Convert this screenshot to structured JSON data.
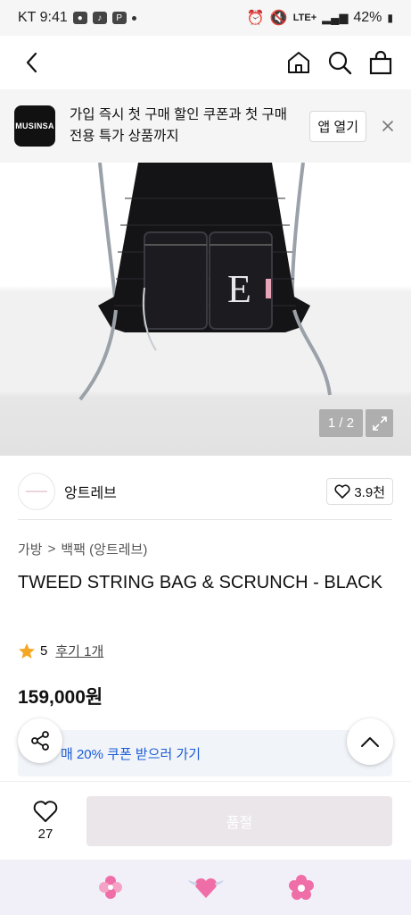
{
  "status_bar": {
    "carrier_time": "KT 9:41",
    "battery": "42%",
    "network": "LTE+"
  },
  "header": {
    "icons": [
      "back-icon",
      "home-icon",
      "search-icon",
      "bag-icon"
    ]
  },
  "promo": {
    "logo_text": "MUSINSA",
    "text": "가입 즉시 첫 구매 할인 쿠폰과 첫 구매 전용 특가 상품까지",
    "open_button": "앱 열기"
  },
  "gallery": {
    "counter": "1 / 2",
    "bag_letter": "E"
  },
  "brand": {
    "name": "앙트레브",
    "likes": "3.9천"
  },
  "breadcrumb": {
    "category": "가방",
    "separator": ">",
    "subcategory": "백팩 (앙트레브)"
  },
  "product": {
    "title": "TWEED STRING BAG & SCRUNCH - BLACK",
    "rating": "5",
    "reviews": "후기 1개",
    "price": "159,000원"
  },
  "coupon": {
    "text": "매 20% 쿠폰 받으러 가기"
  },
  "bottom_bar": {
    "wish_count": "27",
    "soldout_label": "품절"
  },
  "colors": {
    "accent_blue": "#1a5bd6",
    "star": "#f5a623",
    "soldout_bg": "#ebe6ea",
    "nav_pink": "#f06ea8"
  }
}
